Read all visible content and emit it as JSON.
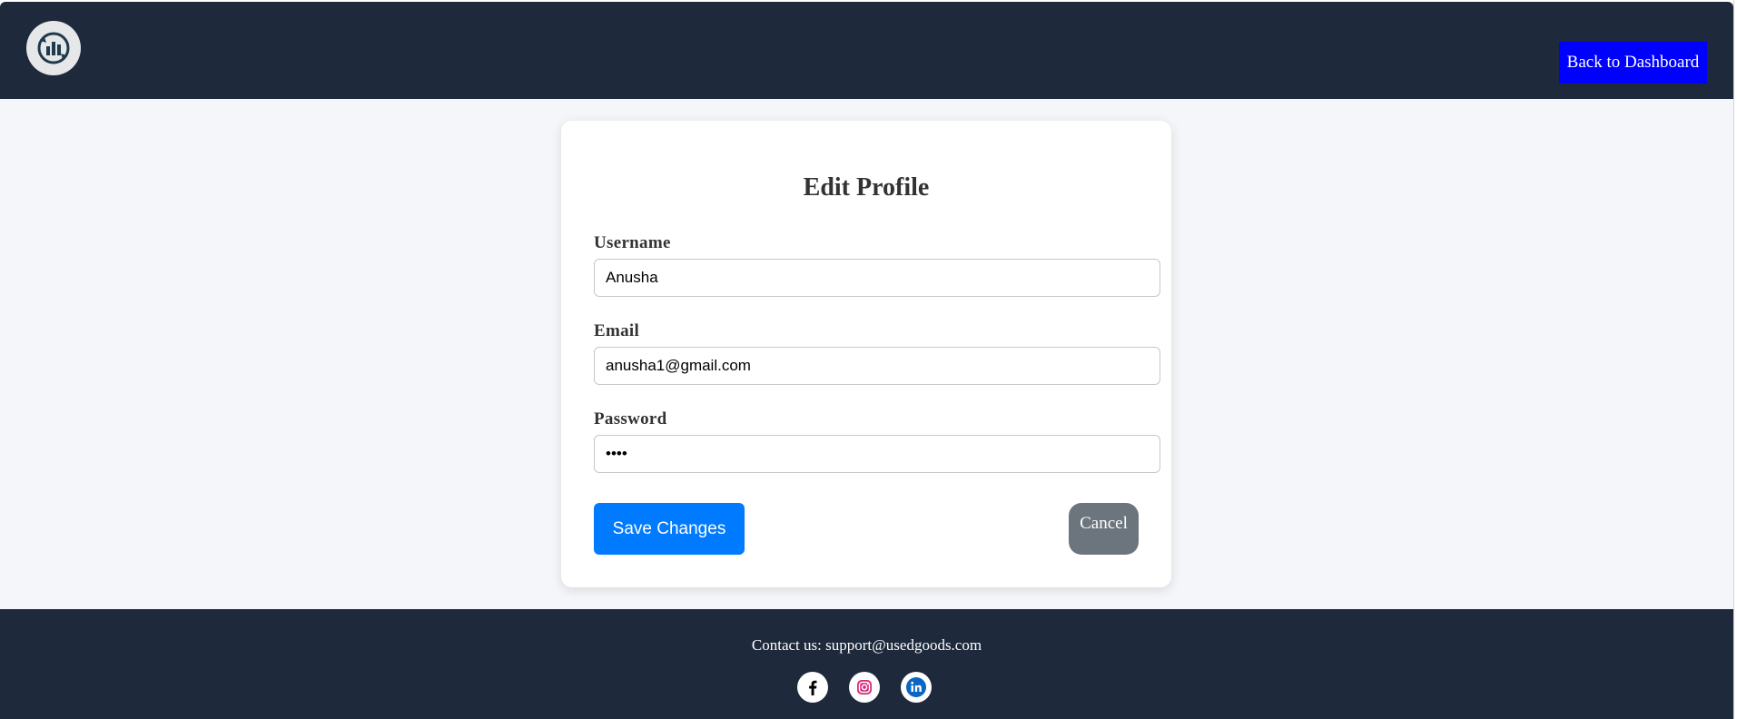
{
  "header": {
    "logo_icon": "recycle-bag-logo-icon",
    "back_button_label": "Back to Dashboard"
  },
  "form": {
    "title": "Edit Profile",
    "username": {
      "label": "Username",
      "value": "Anusha"
    },
    "email": {
      "label": "Email",
      "value": "anusha1@gmail.com"
    },
    "password": {
      "label": "Password",
      "value": "abcd"
    },
    "save_label": "Save Changes",
    "cancel_label": "Cancel"
  },
  "footer": {
    "contact": "Contact us: support@usedgoods.com",
    "socials": [
      {
        "icon": "facebook-icon",
        "color": "#000000"
      },
      {
        "icon": "instagram-icon",
        "color": "#d62976"
      },
      {
        "icon": "linkedin-icon",
        "color": "#0a66c2"
      }
    ]
  },
  "colors": {
    "header_bg": "#1e293b",
    "page_bg": "#f4f6f9",
    "back_button_bg": "#0000ff",
    "save_button_bg": "#007bff",
    "cancel_button_bg": "#6c757d"
  }
}
